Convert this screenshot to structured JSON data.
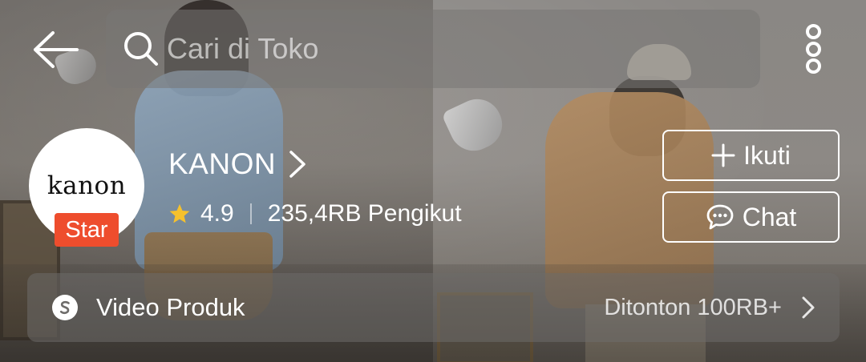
{
  "header": {
    "search_placeholder": "Cari di Toko"
  },
  "shop": {
    "logo_text": "kanon",
    "badge": "Star",
    "name": "KANON",
    "rating": "4.9",
    "followers": "235,4RB Pengikut"
  },
  "actions": {
    "follow_label": "Ikuti",
    "chat_label": "Chat"
  },
  "video": {
    "label": "Video Produk",
    "views": "Ditonton 100RB+"
  },
  "colors": {
    "badge": "#ee4d2d",
    "star": "#f6c12c"
  },
  "icons": [
    "back-arrow-icon",
    "search-icon",
    "more-vertical-icon",
    "chevron-right-icon",
    "star-icon",
    "plus-icon",
    "chat-bubble-icon",
    "video-icon"
  ]
}
